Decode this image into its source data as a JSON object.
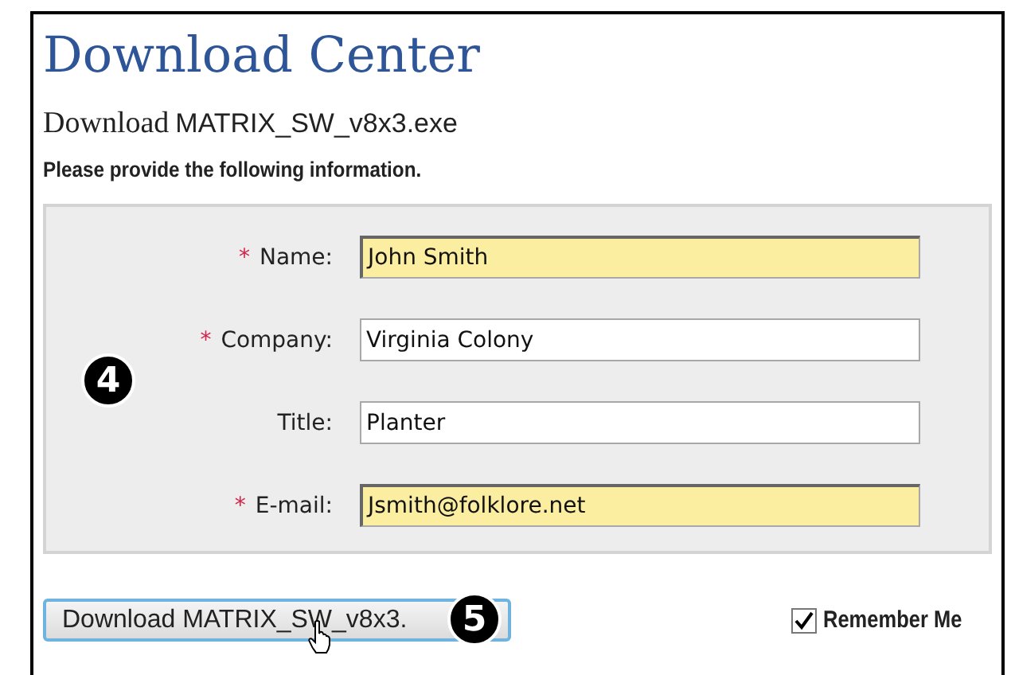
{
  "header": {
    "title": "Download Center",
    "subtitle_prefix": "Download",
    "filename": "MATRIX_SW_v8x3.exe",
    "instruction": "Please provide the following information."
  },
  "form": {
    "required_mark": "*",
    "callout": "4",
    "fields": [
      {
        "label": "Name:",
        "value": "John Smith",
        "required": true,
        "highlighted": true
      },
      {
        "label": "Company:",
        "value": "Virginia Colony",
        "required": true,
        "highlighted": false
      },
      {
        "label": "Title:",
        "value": "Planter",
        "required": false,
        "highlighted": false
      },
      {
        "label": "E-mail:",
        "value": "Jsmith@folklore.net",
        "required": true,
        "highlighted": true
      }
    ]
  },
  "actions": {
    "download_button": "Download MATRIX_SW_v8x3.",
    "callout": "5",
    "remember_me": {
      "label": "Remember Me",
      "checked": true
    }
  }
}
